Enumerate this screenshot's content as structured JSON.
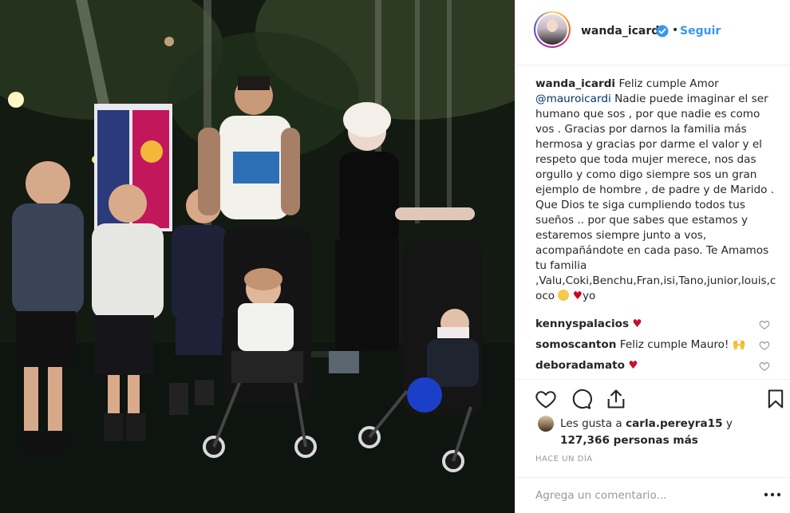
{
  "post": {
    "username": "wanda_icardi",
    "follow_label": "Seguir",
    "dot": "•",
    "caption_username": "wanda_icardi",
    "caption_mention": "@mauroicardi",
    "caption_line1": "Feliz cumple Amor",
    "caption_body": "Nadie puede imaginar el ser humano que sos , por que nadie es como vos . Gracias por darnos la familia más hermosa y gracias por darme el valor y el respeto que toda mujer merece, nos das orgullo y como digo siempre sos un gran ejemplo de hombre , de padre y de Marido . Que Dios te siga cumpliendo todos tus sueños .. por que sabes que estamos y estaremos siempre junto a vos, acompañándote en cada paso. Te Amamos tu familia ,Valu,Coki,Benchu,Fran,isi,Tano,junior,louis,c oco",
    "caption_tail": "yo"
  },
  "comments": [
    {
      "username": "kennyspalacios",
      "text": "",
      "emoji": "heart"
    },
    {
      "username": "somoscanton",
      "text": "Feliz cumple Mauro!",
      "emoji": "praise"
    },
    {
      "username": "deboradamato",
      "text": "",
      "emoji": "heart"
    }
  ],
  "likes": {
    "prefix": "Les gusta a",
    "user": "carla.pereyra15",
    "conj": "y",
    "count": "127,366 personas más"
  },
  "timestamp": "HACE UN DÍA",
  "comment_box": {
    "placeholder": "Agrega un comentario..."
  },
  "icons": {
    "like": "heart-outline-icon",
    "comment": "speech-bubble-icon",
    "share": "share-upload-icon",
    "save": "bookmark-icon",
    "verified": "verified-badge-icon",
    "more": "ellipsis-icon"
  },
  "colors": {
    "link_blue": "#3897f0",
    "verified_blue": "#3897f0",
    "mention": "#003569",
    "muted": "#999999",
    "heart_red": "#c8102e"
  }
}
